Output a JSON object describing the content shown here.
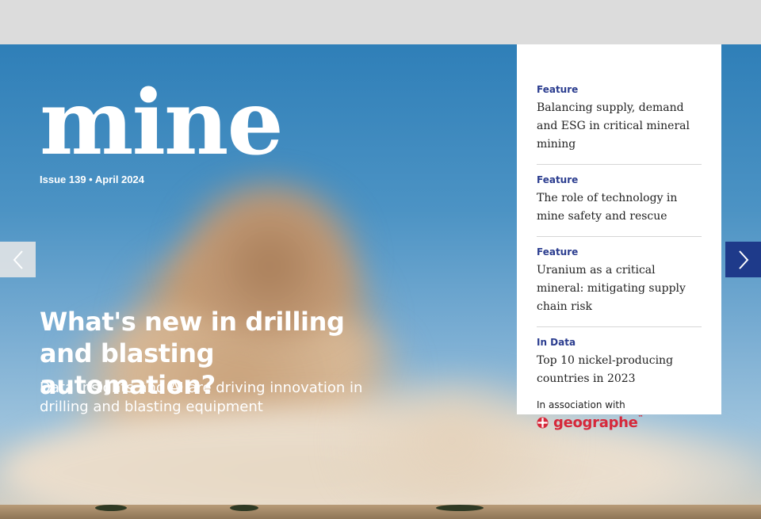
{
  "magazine": {
    "logo": "mine",
    "issue": "Issue 139 • April 2024"
  },
  "hero": {
    "headline": "What's new in drilling and blasting automation?",
    "subhead": "Data insights and AI are driving innovation in drilling and blasting equipment"
  },
  "contents": [
    {
      "category": "Feature",
      "title": "Balancing supply, demand and ESG in critical mineral mining"
    },
    {
      "category": "Feature",
      "title": "The role of technology in mine safety and rescue"
    },
    {
      "category": "Feature",
      "title": "Uranium as a critical mineral: mitigating supply chain risk"
    },
    {
      "category": "In Data",
      "title": "Top 10 nickel-producing countries in 2023"
    }
  ],
  "sponsor": {
    "label": "In association with",
    "brand": "geographe",
    "trademark": "™"
  },
  "colors": {
    "accent": "#2b3d8f",
    "nav_right": "#1e3a8a",
    "brand": "#d6283a"
  },
  "icons": {
    "prev": "chevron-left-icon",
    "next": "chevron-right-icon",
    "brand_mark": "geographe-logo-icon"
  }
}
